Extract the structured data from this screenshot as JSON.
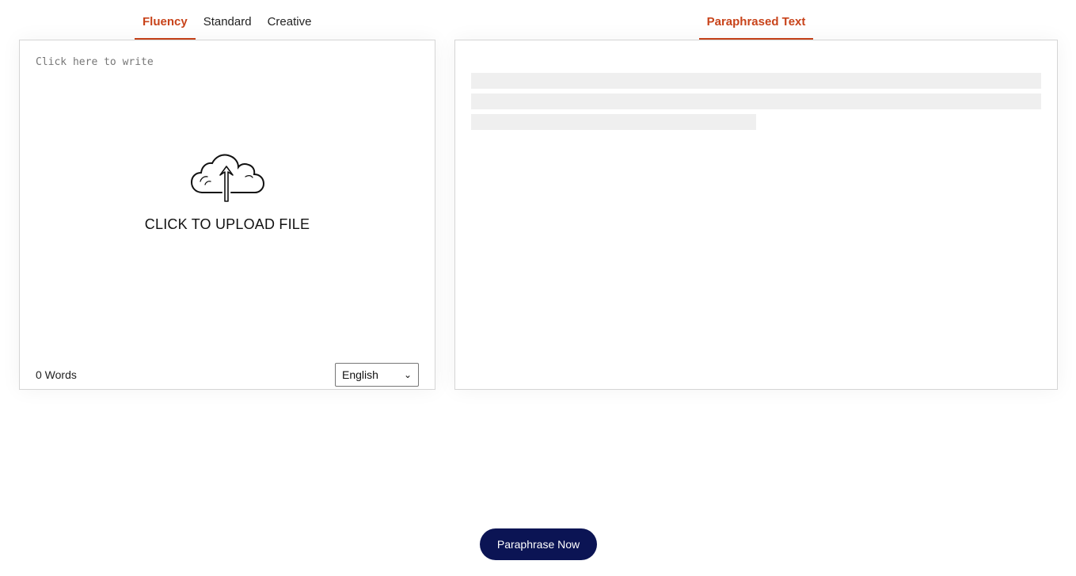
{
  "input_tabs": [
    {
      "label": "Fluency",
      "active": true
    },
    {
      "label": "Standard",
      "active": false
    },
    {
      "label": "Creative",
      "active": false
    }
  ],
  "output_tab": {
    "label": "Paraphrased Text"
  },
  "editor": {
    "placeholder": "Click here to write"
  },
  "upload": {
    "label": "CLICK TO UPLOAD FILE",
    "icon": "cloud-upload-icon"
  },
  "footer": {
    "word_count": "0 Words",
    "language": "English"
  },
  "cta": {
    "label": "Paraphrase Now"
  },
  "colors": {
    "accent": "#c8431a",
    "button": "#0b1454"
  }
}
